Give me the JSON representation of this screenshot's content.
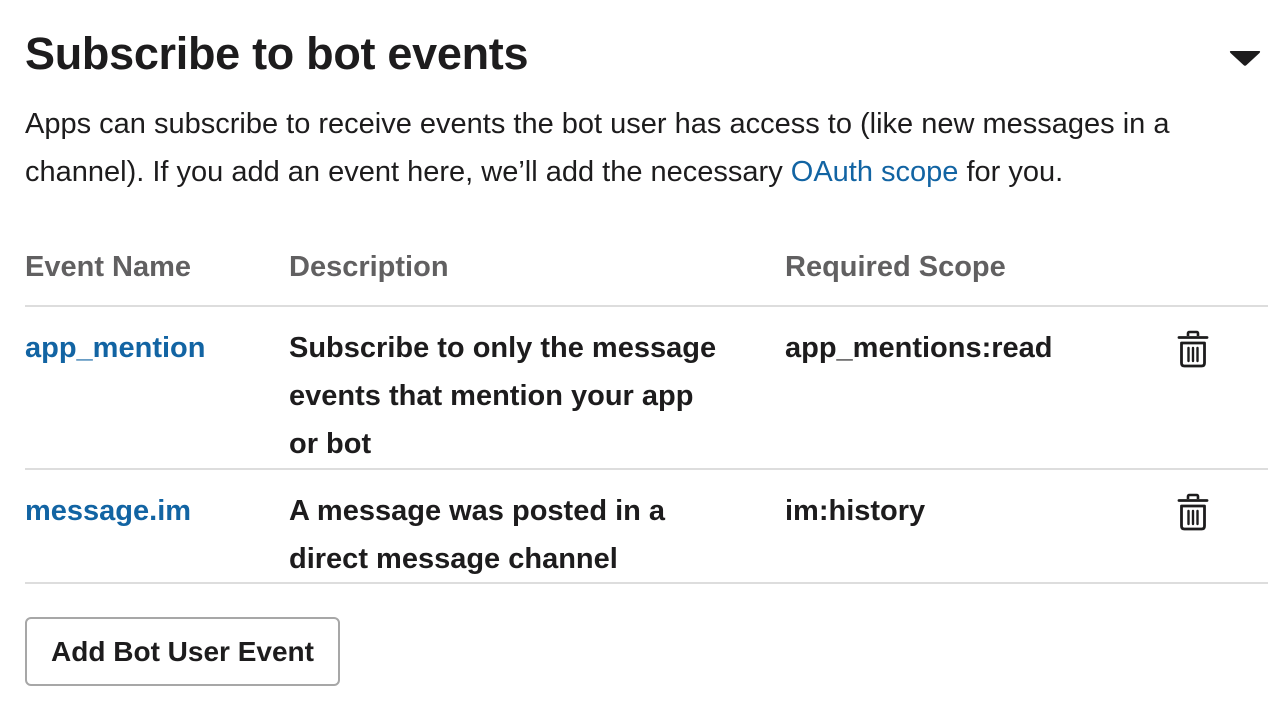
{
  "section": {
    "title": "Subscribe to bot events",
    "toggle_icon": "caret-down-icon"
  },
  "intro": {
    "text_before_link": "Apps can subscribe to receive events the bot user has access to (like new messages in a channel). If you add an event here, we’ll add the necessary ",
    "link_text": "OAuth scope",
    "text_after_link": " for you."
  },
  "table": {
    "headers": {
      "name": "Event Name",
      "description": "Description",
      "scope": "Required Scope"
    },
    "rows": [
      {
        "name": "app_mention",
        "description": "Subscribe to only the message events that mention your app or bot",
        "scope": "app_mentions:read",
        "action_icon": "trash-icon"
      },
      {
        "name": "message.im",
        "description": "A message was posted in a direct message channel",
        "scope": "im:history",
        "action_icon": "trash-icon"
      }
    ]
  },
  "add_button": {
    "label": "Add Bot User Event"
  },
  "colors": {
    "link": "#1264a3",
    "text": "#1d1c1d",
    "header_text": "#616061",
    "divider": "#dddddd",
    "button_border": "#a7a7a7"
  }
}
